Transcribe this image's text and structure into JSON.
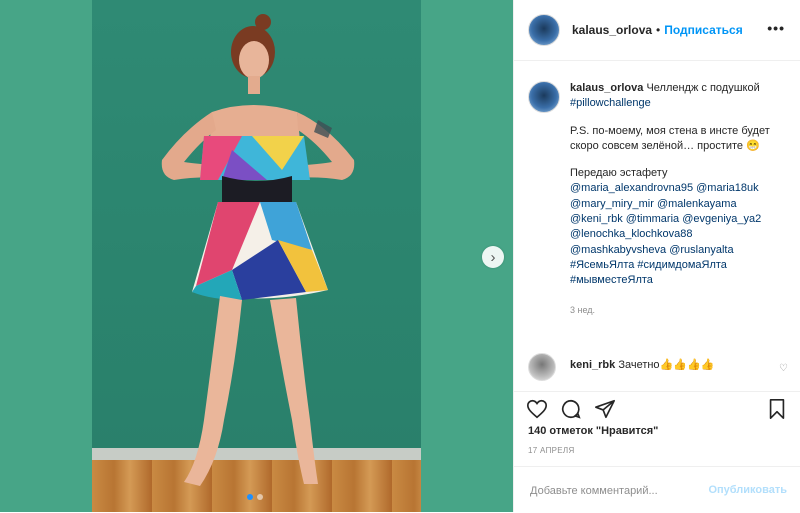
{
  "colors": {
    "accent": "#0095f6",
    "link": "#00376b",
    "muted": "#8e8e8e",
    "photo_bg": "#47a587"
  },
  "header": {
    "username": "kalaus_orlova",
    "separator": "•",
    "follow": "Подписаться",
    "more": "•••"
  },
  "caption": {
    "username": "kalaus_orlova",
    "text": "Челлендж с подушкой",
    "hashtag1": "#pillowchallenge",
    "ps": "P.S. по-моему, моя стена в инсте будет скоро совсем зелёной… простите 😁",
    "relay": "Передаю эстафету",
    "mentions": [
      "@maria_alexandrovna95 @maria18uk",
      "@mary_miry_mir @malenkayama",
      "@keni_rbk @timmaria @evgeniya_ya2",
      "@lenochka_klochkova88",
      "@mashkabyvsheva @ruslanyalta",
      "#ЯсемьЯлта #сидимдомаЯлта",
      "#мывместеЯлта"
    ],
    "time": "3 нед."
  },
  "reply": {
    "username": "keni_rbk",
    "text": "Зачетно👍👍👍👍"
  },
  "stats": {
    "likes": "140 отметок \"Нравится\"",
    "date": "17 АПРЕЛЯ"
  },
  "comment": {
    "placeholder": "Добавьте комментарий...",
    "publish": "Опубликовать"
  },
  "media": {
    "slides": 2,
    "current_slide": 1
  }
}
